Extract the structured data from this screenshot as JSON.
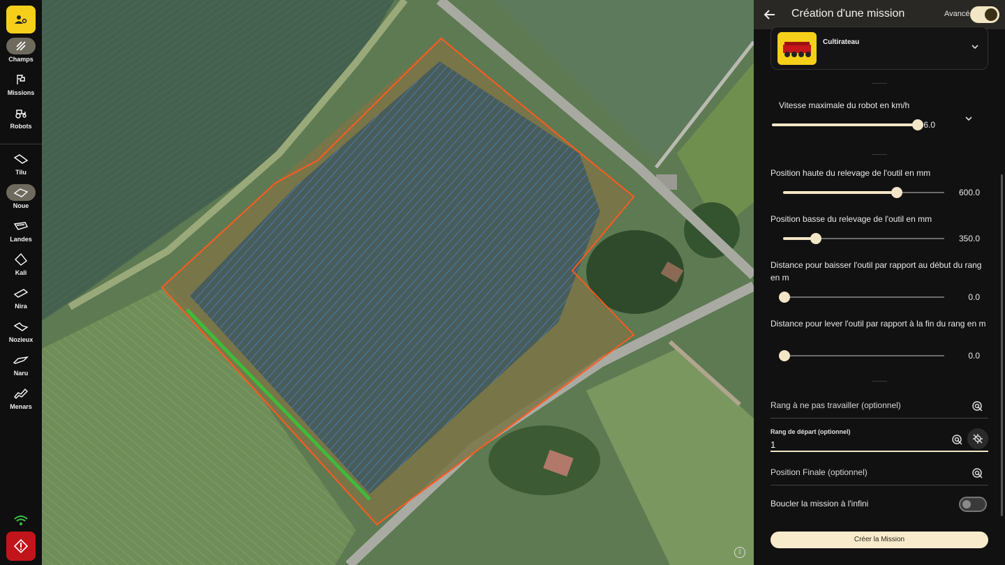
{
  "nav": {
    "items": [
      {
        "label": "Champs",
        "icon": "field-stripes-icon"
      },
      {
        "label": "Missions",
        "icon": "flag-icon"
      },
      {
        "label": "Robots",
        "icon": "tractor-icon"
      },
      {
        "label": "Tilu",
        "icon": "parcel-shape-icon"
      },
      {
        "label": "Noue",
        "icon": "parcel-shape-icon"
      },
      {
        "label": "Landes",
        "icon": "parcel-shape-icon"
      },
      {
        "label": "Kali",
        "icon": "parcel-shape-icon"
      },
      {
        "label": "Nira",
        "icon": "parcel-shape-icon"
      },
      {
        "label": "Nozieux",
        "icon": "parcel-shape-icon"
      },
      {
        "label": "Naru",
        "icon": "parcel-shape-icon"
      },
      {
        "label": "Menars",
        "icon": "parcel-shape-icon"
      }
    ],
    "active": "Noue"
  },
  "colors": {
    "accent": "#f5cf1a",
    "cream": "#f3e6c6",
    "danger": "#c1151b",
    "field_boundary": "#ff5a1f",
    "track_lines": "#4a8fe0",
    "start_row": "#3dbb3a"
  },
  "panel": {
    "title": "Création d'une mission",
    "advanced_label": "Avancé",
    "advanced_on": true,
    "tool": {
      "name": "Cultirateau"
    },
    "speed": {
      "label": "Vitesse maximale du robot en km/h",
      "value": "6.0",
      "fraction": 1.0
    },
    "raise_high": {
      "label": "Position haute du relevage de l'outil en mm",
      "value": "600.0",
      "fraction": 0.71
    },
    "raise_low": {
      "label": "Position basse du relevage de l'outil en mm",
      "value": "350.0",
      "fraction": 0.2
    },
    "lower_dist": {
      "label": "Distance pour baisser l'outil par rapport au début du rang en m",
      "value": "0.0",
      "fraction": 0.0
    },
    "lift_dist": {
      "label": "Distance pour lever l'outil par rapport à la fin du rang en m",
      "value": "0.0",
      "fraction": 0.0
    },
    "skip_row": {
      "label": "Rang à ne pas travailler (optionnel)"
    },
    "start_row": {
      "label": "Rang de départ (optionnel)",
      "value": "1"
    },
    "final_pos": {
      "label": "Position Finale (optionnel)"
    },
    "loop": {
      "label": "Boucler la mission à l'infini",
      "on": false
    },
    "create_label": "Créer la Mission"
  }
}
